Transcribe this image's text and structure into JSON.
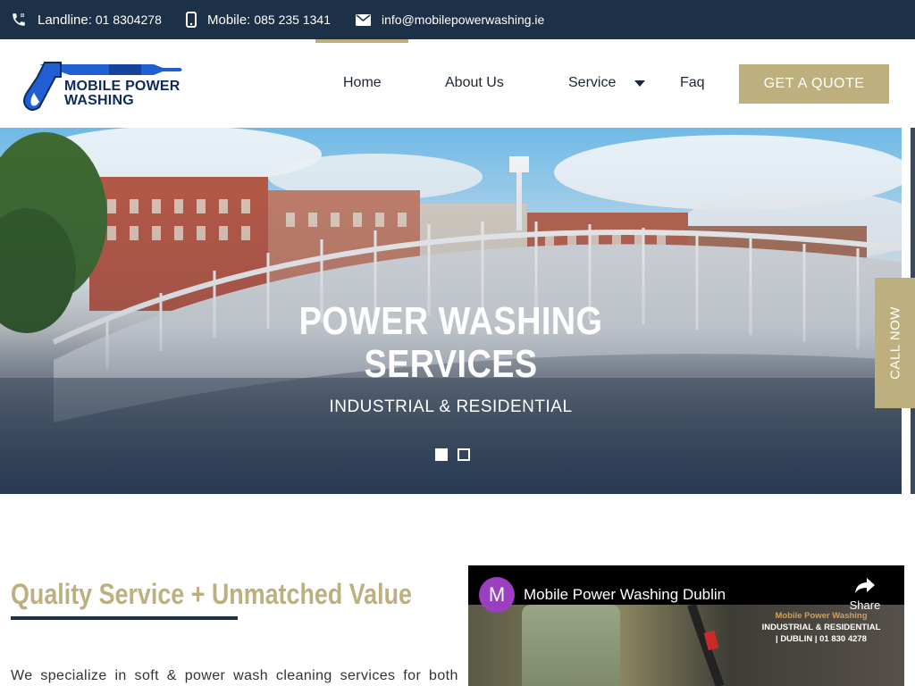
{
  "topbar": {
    "landline_label": "Landline:",
    "landline_value": "01 8304278",
    "mobile_label": "Mobile:",
    "mobile_value": "085 235 1341",
    "email": "info@mobilepowerwashing.ie"
  },
  "logo": {
    "line1": "MOBILE POWER",
    "line2": "WASHING"
  },
  "nav": {
    "items": [
      "Home",
      "About Us",
      "Service",
      "Faq"
    ],
    "active": "Home",
    "quote_button": "GET A QUOTE"
  },
  "hero": {
    "title_line1": "POWER WASHING",
    "title_line2": "SERVICES",
    "subtitle": "INDUSTRIAL & RESIDENTIAL",
    "slide_count": 2,
    "active_slide": 1,
    "call_now": "CALL NOW"
  },
  "content": {
    "heading": "Quality Service + Unmatched Value",
    "paragraph": "We specialize in soft & power wash cleaning services for both"
  },
  "video": {
    "avatar_letter": "M",
    "title": "Mobile Power Washing Dublin",
    "share_label": "Share",
    "overlay_brand": "Mobile Power Washing",
    "overlay_line2": "INDUSTRIAL & RESIDENTIAL",
    "overlay_line3": "| DUBLIN | 01 830 4278"
  },
  "colors": {
    "topbar_bg": "#1c3048",
    "accent_gold": "#bdb07e",
    "logo_blue": "#0e2a5a"
  }
}
